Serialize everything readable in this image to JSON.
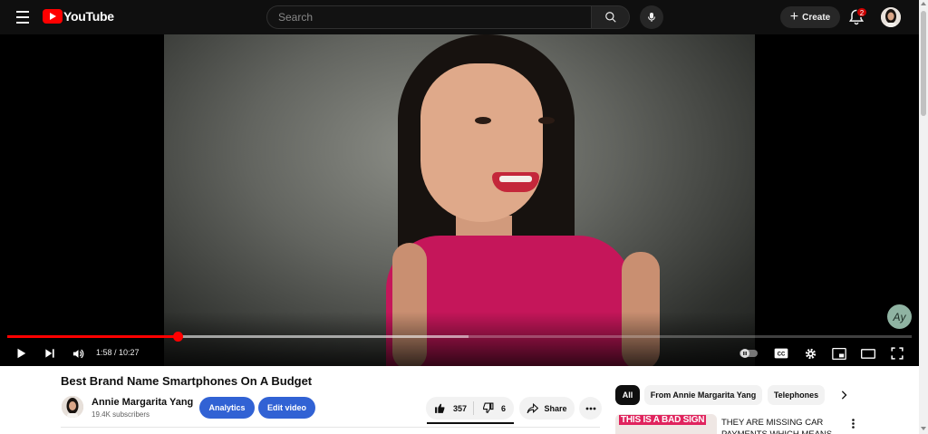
{
  "header": {
    "logo_text": "YouTube",
    "search_placeholder": "Search",
    "create_label": "Create",
    "notification_count": "2"
  },
  "player": {
    "current_time": "1:58",
    "duration": "10:27",
    "time_display": "1:58 / 10:27",
    "progress_fraction": 0.188,
    "buffer_fraction": 0.51,
    "watermark_text": "Ay"
  },
  "video": {
    "title": "Best Brand Name Smartphones On A Budget",
    "channel_name": "Annie Margarita Yang",
    "subscribers": "19.4K subscribers",
    "analytics_label": "Analytics",
    "edit_label": "Edit video",
    "likes": "357",
    "dislikes": "6",
    "share_label": "Share"
  },
  "sidebar": {
    "chips": [
      "All",
      "From Annie Margarita Yang",
      "Telephones"
    ],
    "recommendations": [
      {
        "thumbnail_text": "THIS IS A BAD SIGN",
        "title": "THEY ARE MISSING CAR PAYMENTS WHICH MEANS IT..."
      }
    ]
  },
  "colors": {
    "accent_red": "#ff0000",
    "brand_blue": "#3162d4",
    "topbar_bg": "#0f0f0f",
    "shirt_magenta": "#c5165a"
  },
  "icons": [
    "menu-icon",
    "youtube-logo-icon",
    "search-icon",
    "mic-icon",
    "plus-icon",
    "bell-icon",
    "play-icon",
    "next-icon",
    "volume-icon",
    "autoplay-toggle-icon",
    "captions-icon",
    "settings-icon",
    "miniplayer-icon",
    "theater-icon",
    "fullscreen-icon",
    "thumbs-up-icon",
    "thumbs-down-icon",
    "share-icon",
    "more-icon",
    "chevron-right-icon"
  ]
}
